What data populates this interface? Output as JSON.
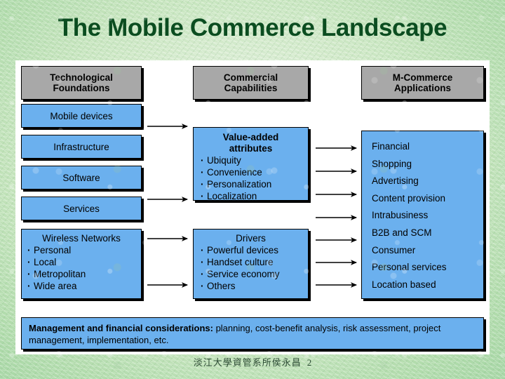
{
  "slide": {
    "title": "The Mobile Commerce Landscape",
    "footer_credit": "淡江大學資管系所侯永昌",
    "page_number": "2"
  },
  "colors": {
    "title_green": "#0b4d20",
    "header_gray": "#a8a8a8",
    "box_blue": "#6bb0ee",
    "panel_white": "#ffffff",
    "outline_black": "#000000"
  },
  "columns": {
    "left": {
      "header": "Technological Foundations",
      "header_line1": "Technological",
      "header_line2": "Foundations",
      "boxes": [
        {
          "label": "Mobile devices"
        },
        {
          "label": "Infrastructure"
        },
        {
          "label": "Software"
        },
        {
          "label": "Services"
        }
      ],
      "list_box": {
        "title": "Wireless Networks",
        "items": [
          "Personal",
          "Local",
          "Metropolitan",
          "Wide area"
        ]
      }
    },
    "middle": {
      "header": "Commercial Capabilities",
      "header_line1": "Commercial",
      "header_line2": "Capabilities",
      "boxes": [
        {
          "title_line1": "Value-added",
          "title_line2": "attributes",
          "items": [
            "Ubiquity",
            "Convenience",
            "Personalization",
            "Localization"
          ]
        },
        {
          "title_line1": "Drivers",
          "title_line2": "",
          "items": [
            "Powerful devices",
            "Handset culture",
            "Service economy",
            "Others"
          ]
        }
      ]
    },
    "right": {
      "header": "M-Commerce Applications",
      "header_line1": "M-Commerce",
      "header_line2": "Applications",
      "items": [
        "Financial",
        "Shopping",
        "Advertising",
        "Content provision",
        "Intrabusiness",
        "B2B and SCM",
        "Consumer",
        "Personal services",
        "Location based"
      ]
    }
  },
  "bottom_bar": {
    "lead": "Management and financial considerations:",
    "body": " planning, cost-benefit analysis, risk assessment, project management, implementation, etc."
  },
  "arrows": {
    "count": 11,
    "direction": "left-to-right",
    "description": "flow arrows connecting Technological Foundations to Commercial Capabilities to M-Commerce Applications"
  }
}
